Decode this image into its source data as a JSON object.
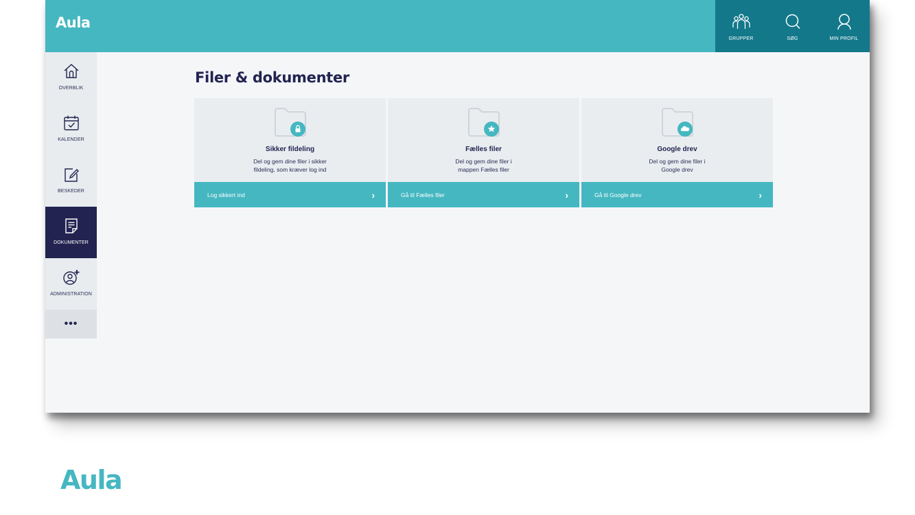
{
  "app": {
    "logo": "Aula"
  },
  "topnav": [
    {
      "label": "GRUPPER",
      "icon": "groups-icon"
    },
    {
      "label": "SØG",
      "icon": "search-icon"
    },
    {
      "label": "MIN PROFIL",
      "icon": "profile-icon"
    }
  ],
  "sidebar": {
    "items": [
      {
        "label": "OVERBLIK",
        "icon": "home-icon"
      },
      {
        "label": "KALENDER",
        "icon": "calendar-icon"
      },
      {
        "label": "BESKEDER",
        "icon": "compose-icon"
      },
      {
        "label": "DOKUMENTER",
        "icon": "document-icon",
        "active": true
      },
      {
        "label": "ADMINISTRATION",
        "icon": "add-user-icon"
      }
    ],
    "more": "•••"
  },
  "page": {
    "title": "Filer & dokumenter"
  },
  "cards": [
    {
      "title": "Sikker fildeling",
      "desc_line1": "Del og gem dine filer i sikker",
      "desc_line2": "fildeling, som kræver log ind",
      "link": "Log sikkert ind",
      "badge_icon": "lock-icon"
    },
    {
      "title": "Fælles filer",
      "desc_line1": "Del og gem dine filer i",
      "desc_line2": "mappen Fælles filer",
      "link": "Gå til Fælles filer",
      "badge_icon": "star-icon"
    },
    {
      "title": "Google drev",
      "desc_line1": "Del og gem dine filer i",
      "desc_line2": "Google drev",
      "link": "Gå til Google drev",
      "badge_icon": "cloud-icon"
    }
  ],
  "footer": {
    "logo": "Aula"
  },
  "colors": {
    "primary": "#45b7c1",
    "topnav_dark": "#13788a",
    "navy": "#222350",
    "background": "#f5f6f8",
    "card": "#e9edf0"
  }
}
